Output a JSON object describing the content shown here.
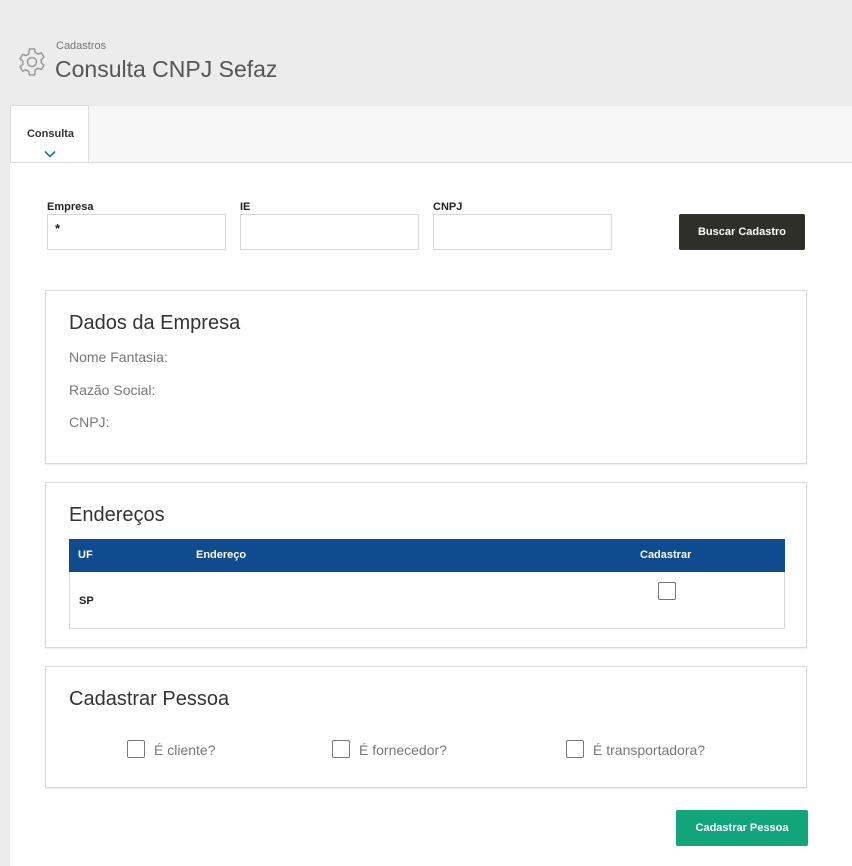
{
  "header": {
    "breadcrumb": "Cadastros",
    "title": "Consulta CNPJ Sefaz",
    "icon": "gear-icon"
  },
  "tabs": [
    {
      "label": "Consulta",
      "active": true
    }
  ],
  "form": {
    "empresa": {
      "label": "Empresa",
      "value": "*"
    },
    "ie": {
      "label": "IE",
      "value": ""
    },
    "cnpj": {
      "label": "CNPJ",
      "value": ""
    },
    "search_button": "Buscar Cadastro"
  },
  "dados": {
    "title": "Dados da Empresa",
    "nome_fantasia": "Nome Fantasia:",
    "razao_social": "Razão Social:",
    "cnpj": "CNPJ:"
  },
  "enderecos": {
    "title": "Endereços",
    "columns": [
      "UF",
      "Endereço",
      "Cadastrar"
    ],
    "rows": [
      {
        "uf": "SP",
        "endereco": "",
        "cadastrar": false
      }
    ]
  },
  "cadastrar_pessoa": {
    "title": "Cadastrar Pessoa",
    "options": [
      {
        "label": "É cliente?",
        "checked": false
      },
      {
        "label": "É fornecedor?",
        "checked": false
      },
      {
        "label": "É transportadora?",
        "checked": false
      }
    ],
    "submit_button": "Cadastrar Pessoa"
  },
  "colors": {
    "table_header": "#0f4c8f",
    "dark_button": "#2f2f2a",
    "green_button": "#10a57a",
    "tab_chevron": "#1a73c7"
  }
}
